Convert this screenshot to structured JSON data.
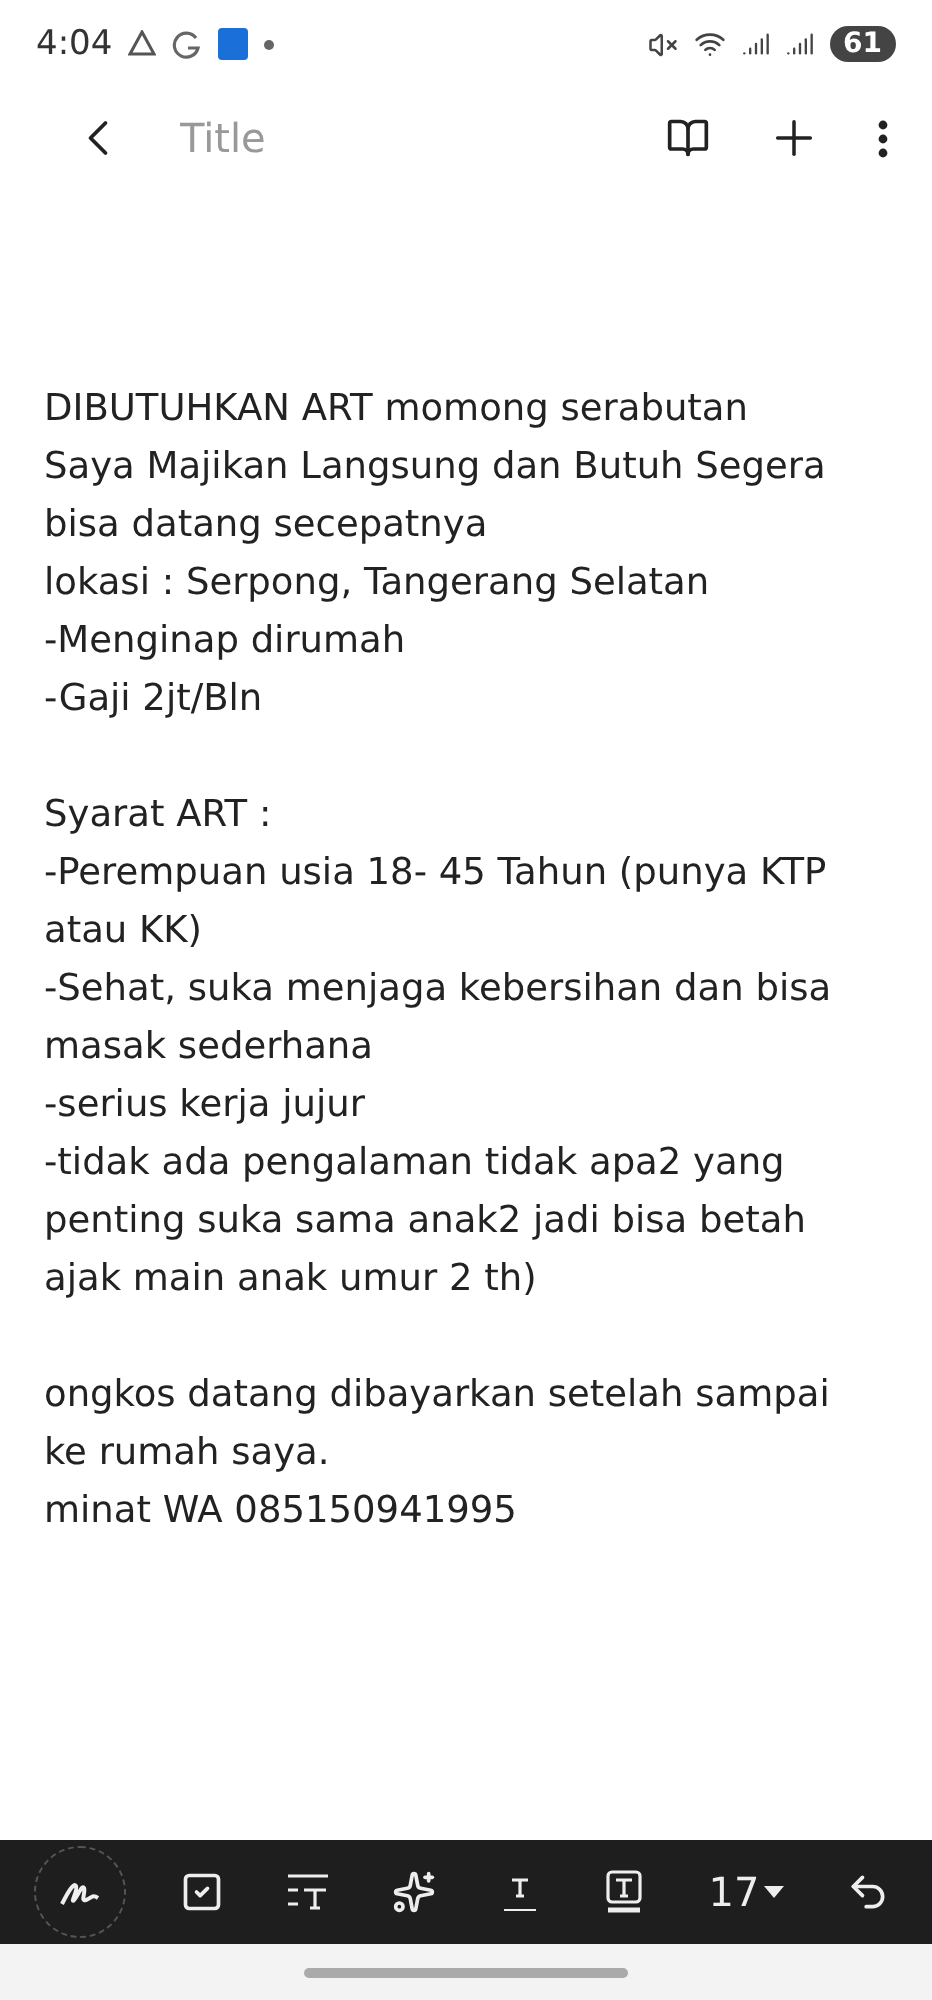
{
  "status_bar": {
    "time": "4:04",
    "battery": "61"
  },
  "header": {
    "title_placeholder": "Title"
  },
  "note": {
    "blocks": [
      [
        "DIBUTUHKAN ART momong serabutan",
        "Saya Majikan Langsung dan Butuh Segera",
        "bisa datang secepatnya",
        "lokasi : Serpong, Tangerang Selatan",
        "-Menginap dirumah",
        "-Gaji 2jt/Bln"
      ],
      [
        "Syarat ART :",
        "-Perempuan usia 18- 45 Tahun (punya KTP",
        "atau KK)",
        "-Sehat, suka menjaga kebersihan dan bisa",
        "masak sederhana",
        "-serius kerja jujur",
        "-tidak ada pengalaman tidak apa2 yang",
        "penting suka sama anak2 jadi bisa betah",
        "ajak main anak umur 2 th)"
      ],
      [
        "ongkos datang dibayarkan setelah sampai",
        "ke rumah saya.",
        "minat WA 085150941995"
      ]
    ]
  },
  "toolbar": {
    "font_size": "17"
  }
}
